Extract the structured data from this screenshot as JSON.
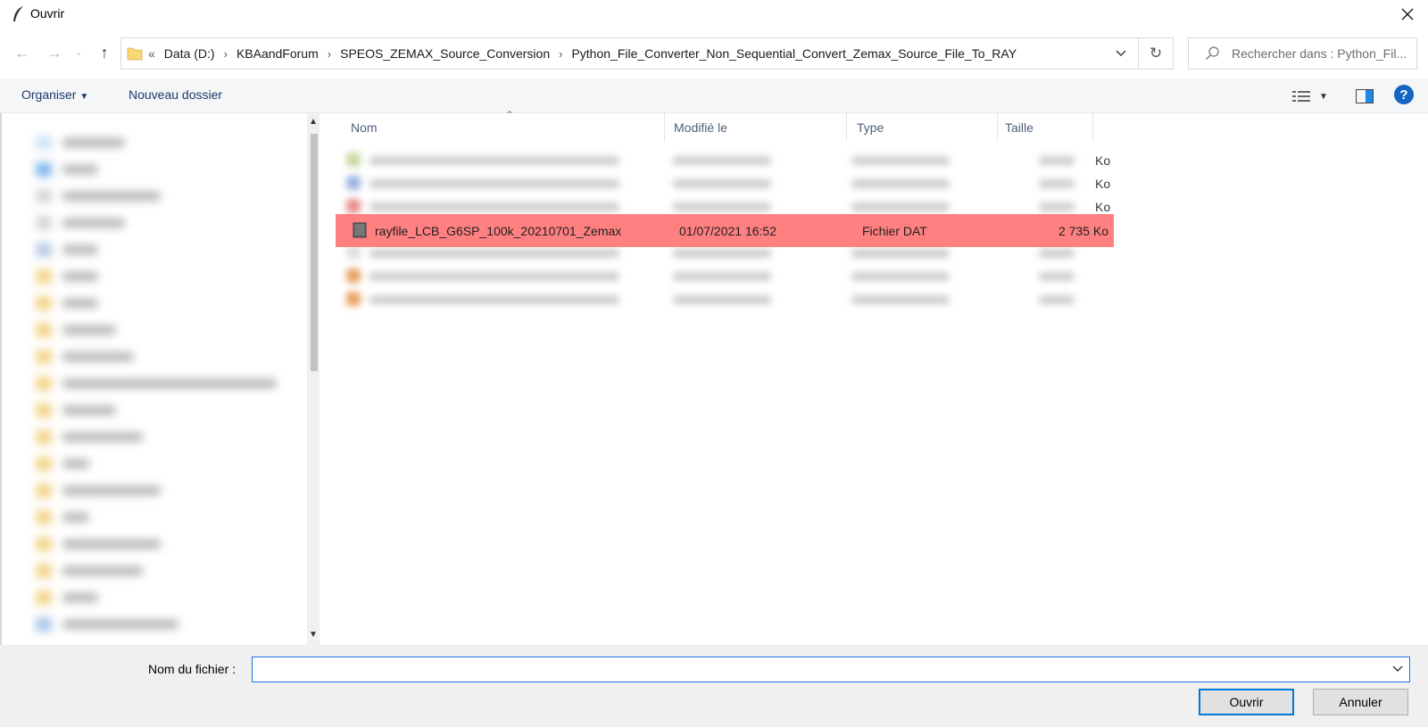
{
  "window": {
    "title": "Ouvrir"
  },
  "address": {
    "prefix": "«",
    "crumbs": [
      "Data (D:)",
      "KBAandForum",
      "SPEOS_ZEMAX_Source_Conversion",
      "Python_File_Converter_Non_Sequential_Convert_Zemax_Source_File_To_RAY"
    ]
  },
  "search": {
    "placeholder": "Rechercher dans : Python_Fil..."
  },
  "toolbar": {
    "organise_label": "Organiser",
    "new_folder_label": "Nouveau dossier"
  },
  "columns": {
    "name": "Nom",
    "modified": "Modifié le",
    "type": "Type",
    "size": "Taille"
  },
  "partial_sizes": [
    "Ko",
    "Ko",
    "Ko"
  ],
  "selected_file": {
    "name": "rayfile_LCB_G6SP_100k_20210701_Zemax",
    "modified": "01/07/2021 16:52",
    "type": "Fichier DAT",
    "size": "2 735 Ko"
  },
  "bottom": {
    "filename_label": "Nom du fichier :",
    "filename_value": "",
    "open_label": "Ouvrir",
    "cancel_label": "Annuler"
  },
  "colors": {
    "selection": "#ff8080",
    "accent": "#0078d7",
    "help": "#1565c0"
  }
}
